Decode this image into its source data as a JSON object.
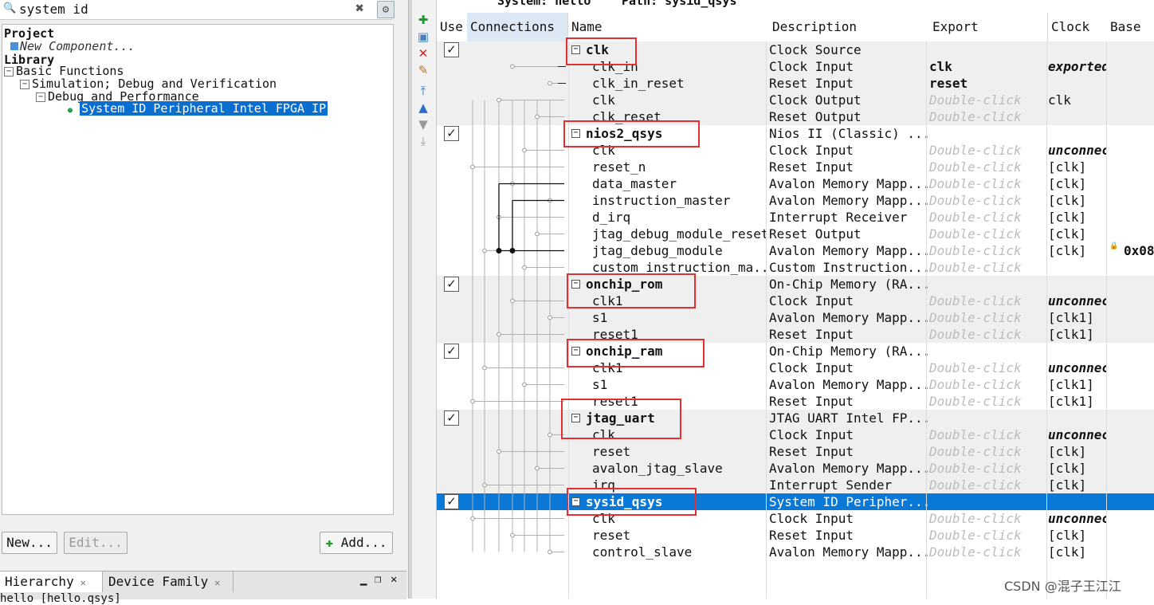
{
  "search": {
    "value": "system id",
    "clear_glyph": "✖"
  },
  "tree": {
    "project_label": "Project",
    "new_component": "New Component...",
    "library_label": "Library",
    "basic_functions": "Basic Functions",
    "simulation": "Simulation; Debug and Verification",
    "debug_perf": "Debug and Performance",
    "selected_ip": "System ID Peripheral Intel FPGA IP"
  },
  "left_buttons": {
    "new": "New...",
    "edit": "Edit...",
    "add": "Add..."
  },
  "bottom_tabs": {
    "hierarchy": "Hierarchy",
    "device_family": "Device Family"
  },
  "hier_text": "hello [hello.qsys]",
  "system_header": {
    "system": "System: hello",
    "path": "Path: sysid_qsys"
  },
  "columns": {
    "use": "Use",
    "connections": "Connections",
    "name": "Name",
    "description": "Description",
    "export": "Export",
    "clock": "Clock",
    "base": "Base"
  },
  "double_click": "Double-click",
  "rows": [
    {
      "type": "comp",
      "name": "clk",
      "desc": "Clock Source",
      "export": "",
      "clock": "",
      "shaded": true
    },
    {
      "type": "port",
      "name": "clk_in",
      "desc": "Clock Input",
      "export": "clk",
      "export_style": "bold",
      "clock": "exported",
      "clock_style": "bolditalic",
      "shaded": true
    },
    {
      "type": "port",
      "name": "clk_in_reset",
      "desc": "Reset Input",
      "export": "reset",
      "export_style": "bold",
      "clock": "",
      "shaded": true
    },
    {
      "type": "port",
      "name": "clk",
      "desc": "Clock Output",
      "export": "Double-click",
      "export_style": "dbl",
      "clock": "clk",
      "shaded": true
    },
    {
      "type": "port",
      "name": "clk_reset",
      "desc": "Reset Output",
      "export": "Double-click",
      "export_style": "dbl",
      "clock": "",
      "shaded": true
    },
    {
      "type": "comp",
      "name": "nios2_qsys",
      "desc": "Nios II (Classic) ...",
      "export": "",
      "clock": "",
      "shaded": false
    },
    {
      "type": "port",
      "name": "clk",
      "desc": "Clock Input",
      "export": "Double-click",
      "export_style": "dbl",
      "clock": "unconnected",
      "clock_style": "bolditalic",
      "shaded": false
    },
    {
      "type": "port",
      "name": "reset_n",
      "desc": "Reset Input",
      "export": "Double-click",
      "export_style": "dbl",
      "clock": "[clk]",
      "shaded": false
    },
    {
      "type": "port",
      "name": "data_master",
      "desc": "Avalon Memory Mapp...",
      "export": "Double-click",
      "export_style": "dbl",
      "clock": "[clk]",
      "shaded": false
    },
    {
      "type": "port",
      "name": "instruction_master",
      "desc": "Avalon Memory Mapp...",
      "export": "Double-click",
      "export_style": "dbl",
      "clock": "[clk]",
      "shaded": false
    },
    {
      "type": "port",
      "name": "d_irq",
      "desc": "Interrupt Receiver",
      "export": "Double-click",
      "export_style": "dbl",
      "clock": "[clk]",
      "shaded": false
    },
    {
      "type": "port",
      "name": "jtag_debug_module_reset",
      "desc": "Reset Output",
      "export": "Double-click",
      "export_style": "dbl",
      "clock": "[clk]",
      "shaded": false
    },
    {
      "type": "port",
      "name": "jtag_debug_module",
      "desc": "Avalon Memory Mapp...",
      "export": "Double-click",
      "export_style": "dbl",
      "clock": "[clk]",
      "base": "0x08",
      "shaded": false
    },
    {
      "type": "port",
      "name": "custom_instruction_ma...",
      "desc": "Custom Instruction...",
      "export": "Double-click",
      "export_style": "dbl",
      "clock": "",
      "shaded": false
    },
    {
      "type": "comp",
      "name": "onchip_rom",
      "desc": "On-Chip Memory (RA...",
      "export": "",
      "clock": "",
      "shaded": true
    },
    {
      "type": "port",
      "name": "clk1",
      "desc": "Clock Input",
      "export": "Double-click",
      "export_style": "dbl",
      "clock": "unconnected",
      "clock_style": "bolditalic",
      "shaded": true
    },
    {
      "type": "port",
      "name": "s1",
      "desc": "Avalon Memory Mapp...",
      "export": "Double-click",
      "export_style": "dbl",
      "clock": "[clk1]",
      "shaded": true
    },
    {
      "type": "port",
      "name": "reset1",
      "desc": "Reset Input",
      "export": "Double-click",
      "export_style": "dbl",
      "clock": "[clk1]",
      "shaded": true
    },
    {
      "type": "comp",
      "name": "onchip_ram",
      "desc": "On-Chip Memory (RA...",
      "export": "",
      "clock": "",
      "shaded": false
    },
    {
      "type": "port",
      "name": "clk1",
      "desc": "Clock Input",
      "export": "Double-click",
      "export_style": "dbl",
      "clock": "unconnected",
      "clock_style": "bolditalic",
      "shaded": false
    },
    {
      "type": "port",
      "name": "s1",
      "desc": "Avalon Memory Mapp...",
      "export": "Double-click",
      "export_style": "dbl",
      "clock": "[clk1]",
      "shaded": false
    },
    {
      "type": "port",
      "name": "reset1",
      "desc": "Reset Input",
      "export": "Double-click",
      "export_style": "dbl",
      "clock": "[clk1]",
      "shaded": false
    },
    {
      "type": "comp",
      "name": "jtag_uart",
      "desc": "JTAG UART Intel FP...",
      "export": "",
      "clock": "",
      "shaded": true
    },
    {
      "type": "port",
      "name": "clk",
      "desc": "Clock Input",
      "export": "Double-click",
      "export_style": "dbl",
      "clock": "unconnected",
      "clock_style": "bolditalic",
      "shaded": true
    },
    {
      "type": "port",
      "name": "reset",
      "desc": "Reset Input",
      "export": "Double-click",
      "export_style": "dbl",
      "clock": "[clk]",
      "shaded": true
    },
    {
      "type": "port",
      "name": "avalon_jtag_slave",
      "desc": "Avalon Memory Mapp...",
      "export": "Double-click",
      "export_style": "dbl",
      "clock": "[clk]",
      "shaded": true
    },
    {
      "type": "port",
      "name": "irq",
      "desc": "Interrupt Sender",
      "export": "Double-click",
      "export_style": "dbl",
      "clock": "[clk]",
      "shaded": true
    },
    {
      "type": "comp",
      "name": "sysid_qsys",
      "desc": "System ID Peripher...",
      "export": "",
      "clock": "",
      "shaded": false,
      "selected": true
    },
    {
      "type": "port",
      "name": "clk",
      "desc": "Clock Input",
      "export": "Double-click",
      "export_style": "dbl",
      "clock": "unconnected",
      "clock_style": "bolditalic",
      "shaded": false
    },
    {
      "type": "port",
      "name": "reset",
      "desc": "Reset Input",
      "export": "Double-click",
      "export_style": "dbl",
      "clock": "[clk]",
      "shaded": false
    },
    {
      "type": "port",
      "name": "control_slave",
      "desc": "Avalon Memory Mapp...",
      "export": "Double-click",
      "export_style": "dbl",
      "clock": "[clk]",
      "shaded": false
    }
  ],
  "watermark": "CSDN @混子王江江",
  "colors": {
    "selection": "#0a78d7",
    "highlight_box": "#e03030",
    "shaded_row": "#efefef"
  }
}
